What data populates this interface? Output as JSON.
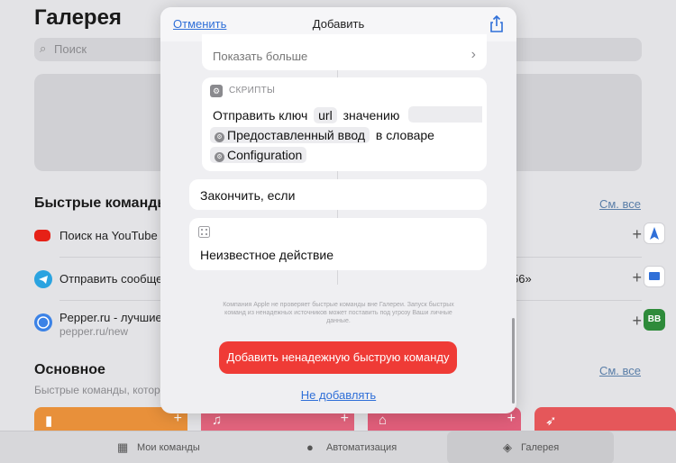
{
  "background": {
    "title": "Галерея",
    "search_placeholder": "Поиск",
    "section_quick": "Быстрые команды",
    "see_all": "См. все",
    "quick_items": [
      {
        "title": "Поиск на YouTube",
        "subtitle": ""
      },
      {
        "title": "Отправить сообще",
        "subtitle": "",
        "right_text": "56»"
      },
      {
        "title": "Pepper.ru - лучшие",
        "subtitle": "pepper.ru/new",
        "tile_text": "BB"
      }
    ],
    "section_main": "Основное",
    "main_subtitle": "Быстрые команды, котор",
    "tab_bar": [
      {
        "label": "Мои команды"
      },
      {
        "label": "Автоматизация"
      },
      {
        "label": "Галерея",
        "active": true
      }
    ]
  },
  "modal": {
    "cancel_label": "Отменить",
    "title": "Добавить",
    "show_more_label": "Показать больше",
    "scripts_card": {
      "category_label": "СКРИПТЫ",
      "line1_prefix": "Отправить ключ",
      "key_token": "url",
      "line1_suffix": "значению",
      "input_token": "Предоставленный ввод",
      "line2_suffix": "в словаре",
      "dict_token": "Configuration"
    },
    "end_if_label": "Закончить, если",
    "unknown_action_label": "Неизвестное действие",
    "disclaimer": "Компания Apple не проверяет быстрые команды вне Галереи. Запуск быстрых команд из ненадежных источников может поставить под угрозу Ваши личные данные.",
    "add_button_label": "Добавить ненадежную быструю команду",
    "dont_add_label": "Не добавлять"
  },
  "colors": {
    "accent_blue": "#2f6fd8",
    "danger_red": "#ef3b36"
  }
}
